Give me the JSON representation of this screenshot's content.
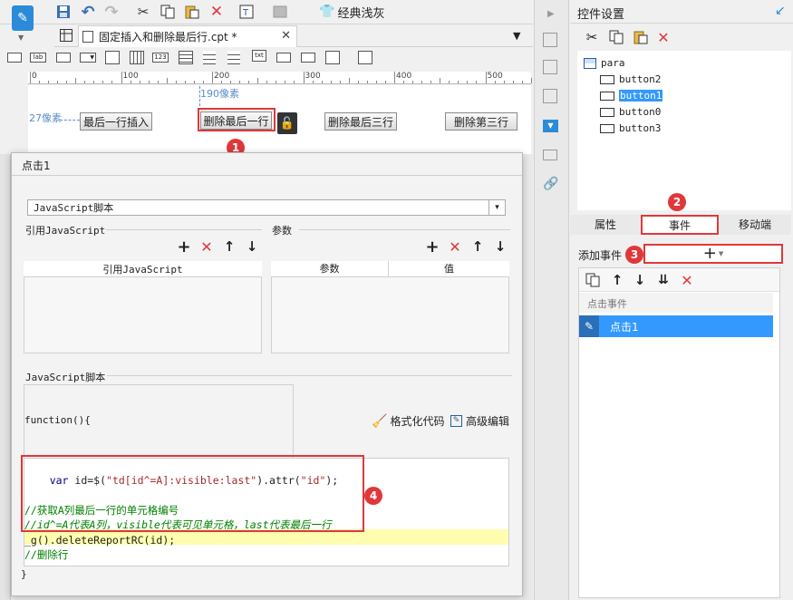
{
  "toolbar": {
    "theme_label": "经典浅灰"
  },
  "tab": {
    "title": "固定插入和删除最后行.cpt *"
  },
  "ruler": {
    "ticks": [
      "0",
      "100",
      "200",
      "300",
      "400",
      "500"
    ],
    "hint_top": "190像素",
    "hint_left": "27像素"
  },
  "canvas_buttons": [
    "最后一行插入",
    "删除最后一行",
    "删除最后三行",
    "删除第三行"
  ],
  "dialog": {
    "title": "点击1",
    "type_select": "JavaScript脚本",
    "ref_js_label": "引用JavaScript",
    "ref_js_col": "引用JavaScript",
    "params_label": "参数",
    "params_col_name": "参数",
    "params_col_value": "值",
    "script_label": "JavaScript脚本",
    "func_open": "function(){",
    "format_label": "格式化代码",
    "adv_label": "高级编辑",
    "code": [
      {
        "k": "var",
        "t": " id=$(",
        "s": "\"td[id^=A]:visible:last\"",
        "t2": ").attr(",
        "s2": "\"id\"",
        "t3": ");"
      },
      {
        "c": "//获取A列最后一行的单元格编号"
      },
      {
        "c": "//id^=A代表A列，visible代表可见单元格，last代表最后一行"
      },
      {
        "p": "_g().deleteReportRC(id);"
      },
      {
        "c": "//删除行"
      }
    ],
    "func_close": "}"
  },
  "right_panel": {
    "title": "控件设置",
    "tree": [
      "para",
      "button2",
      "button1",
      "button0",
      "button3"
    ],
    "tabs": [
      "属性",
      "事件",
      "移动端"
    ],
    "add_event_label": "添加事件",
    "event_group": "点击事件",
    "event_item": "点击1"
  },
  "badges": [
    "1",
    "2",
    "3",
    "4"
  ],
  "colors": {
    "accent": "#2c8bd8",
    "annotation": "#e0383a",
    "selection": "#3399ff",
    "keyword": "#00008b",
    "string": "#a52a2a",
    "comment": "#008000",
    "highlight_line": "#fffdb0"
  }
}
